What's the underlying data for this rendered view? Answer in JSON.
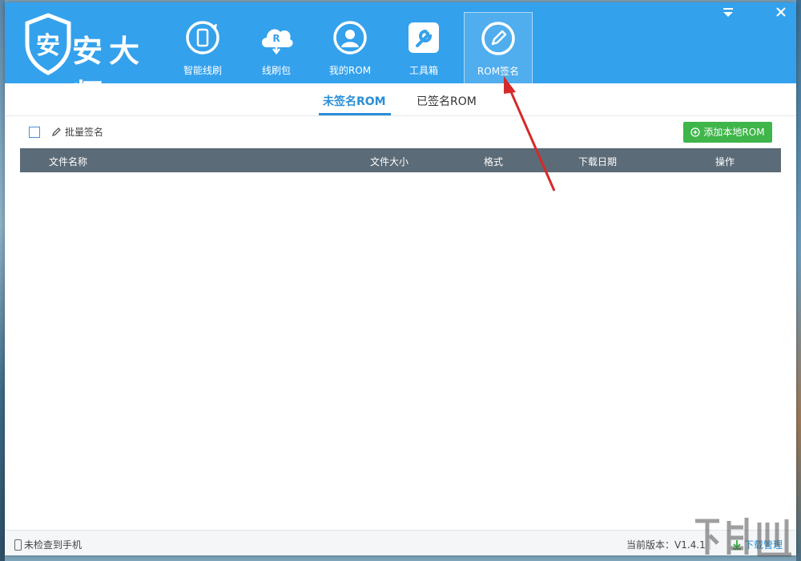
{
  "app": {
    "logo_text": "安大师",
    "logo_icon_text": "安"
  },
  "nav": [
    {
      "label": "智能线刷",
      "icon": "phone-refresh-icon",
      "active": false
    },
    {
      "label": "线刷包",
      "icon": "cloud-download-icon",
      "icon_letter": "R",
      "active": false
    },
    {
      "label": "我的ROM",
      "icon": "user-icon",
      "active": false
    },
    {
      "label": "工具箱",
      "icon": "wrench-icon",
      "active": false
    },
    {
      "label": "ROM签名",
      "icon": "pen-icon",
      "active": true
    }
  ],
  "window_controls": {
    "menu": "menu-icon",
    "close": "close-icon"
  },
  "subtabs": [
    {
      "label": "未签名ROM",
      "active": true
    },
    {
      "label": "已签名ROM",
      "active": false
    }
  ],
  "toolbar": {
    "batch_sign_label": "批量签名",
    "add_local_rom_label": "添加本地ROM"
  },
  "table": {
    "columns": [
      "文件名称",
      "文件大小",
      "格式",
      "下载日期",
      "操作"
    ],
    "rows": []
  },
  "status": {
    "device_status": "未检查到手机",
    "version_label": "当前版本：V1.4.1",
    "download_manager": "下载管理"
  },
  "colors": {
    "header_blue": "#34a1ec",
    "accent_blue": "#2b8fd6",
    "add_button_green": "#3fb54a",
    "table_header": "#5b6b77",
    "annotation_arrow": "#d42a2a"
  }
}
